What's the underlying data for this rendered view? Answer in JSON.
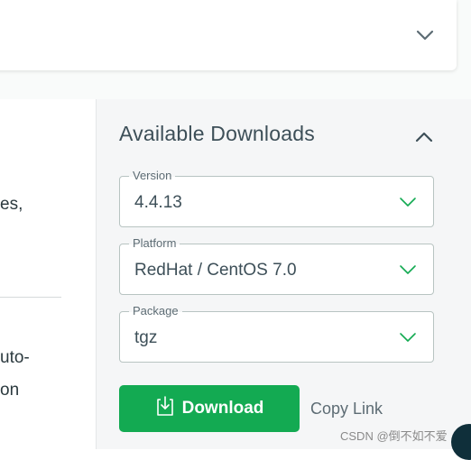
{
  "left_panel": {
    "line1": "es,",
    "line2": "uto-",
    "line3": "on"
  },
  "downloads": {
    "title": "Available Downloads",
    "version": {
      "label": "Version",
      "value": "4.4.13"
    },
    "platform": {
      "label": "Platform",
      "value": "RedHat / CentOS 7.0"
    },
    "package": {
      "label": "Package",
      "value": "tgz"
    },
    "download_button": "Download",
    "copy_link": "Copy Link"
  },
  "watermark": "CSDN @倒不如不爱",
  "colors": {
    "accent_green": "#13aa52",
    "chevron_green": "#13aa52",
    "text_dark": "#3d4f58"
  },
  "icons": {
    "top": "chevron-down-icon",
    "pane": "chevron-up-icon",
    "field": "chevron-down-icon",
    "download": "download-icon"
  }
}
